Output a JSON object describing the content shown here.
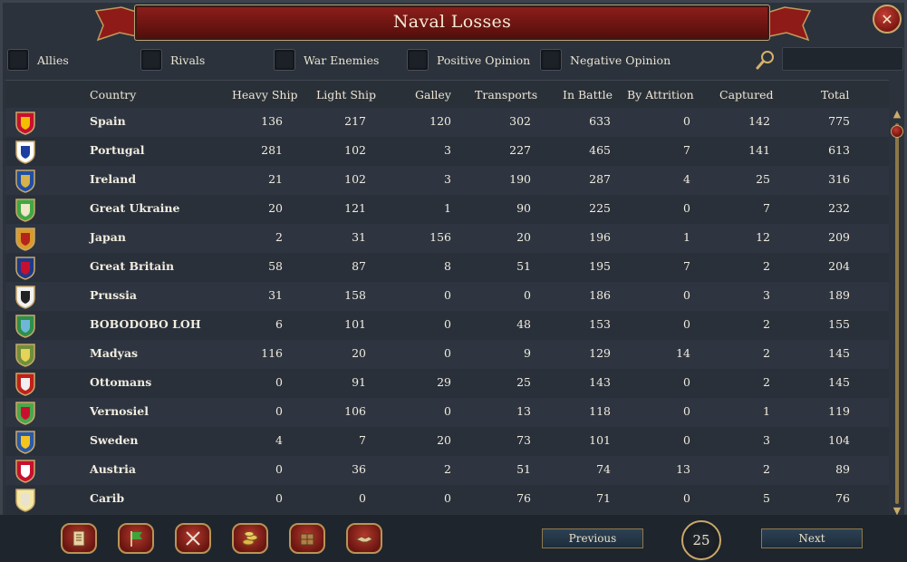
{
  "window": {
    "title": "Naval Losses"
  },
  "filters": [
    {
      "label": "Allies"
    },
    {
      "label": "Rivals"
    },
    {
      "label": "War Enemies"
    },
    {
      "label": "Positive Opinion"
    },
    {
      "label": "Negative Opinion"
    }
  ],
  "search": {
    "value": "",
    "placeholder": ""
  },
  "table": {
    "columns": [
      "Country",
      "Heavy Ship",
      "Light Ship",
      "Galley",
      "Transports",
      "In Battle",
      "By Attrition",
      "Captured",
      "Total"
    ],
    "rows": [
      {
        "flag": "spain-flag",
        "colors": [
          "#c8102e",
          "#f1bf00"
        ],
        "name": "Spain",
        "heavy": "136",
        "light": "217",
        "galley": "120",
        "transports": "302",
        "battle": "633",
        "attrition": "0",
        "captured": "142",
        "total": "775"
      },
      {
        "flag": "portugal-flag",
        "colors": [
          "#ffffff",
          "#1d3f9e"
        ],
        "name": "Portugal",
        "heavy": "281",
        "light": "102",
        "galley": "3",
        "transports": "227",
        "battle": "465",
        "attrition": "7",
        "captured": "141",
        "total": "613"
      },
      {
        "flag": "ireland-flag",
        "colors": [
          "#1f4fa3",
          "#d6b24a"
        ],
        "name": "Ireland",
        "heavy": "21",
        "light": "102",
        "galley": "3",
        "transports": "190",
        "battle": "287",
        "attrition": "4",
        "captured": "25",
        "total": "316"
      },
      {
        "flag": "great-ukraine-flag",
        "colors": [
          "#3fa844",
          "#f0e6c8"
        ],
        "name": "Great Ukraine",
        "heavy": "20",
        "light": "121",
        "galley": "1",
        "transports": "90",
        "battle": "225",
        "attrition": "0",
        "captured": "7",
        "total": "232"
      },
      {
        "flag": "japan-flag",
        "colors": [
          "#d89a2a",
          "#b4231c"
        ],
        "name": "Japan",
        "heavy": "2",
        "light": "31",
        "galley": "156",
        "transports": "20",
        "battle": "196",
        "attrition": "1",
        "captured": "12",
        "total": "209"
      },
      {
        "flag": "great-britain-flag",
        "colors": [
          "#1d3a8a",
          "#c8102e"
        ],
        "name": "Great Britain",
        "heavy": "58",
        "light": "87",
        "galley": "8",
        "transports": "51",
        "battle": "195",
        "attrition": "7",
        "captured": "2",
        "total": "204"
      },
      {
        "flag": "prussia-flag",
        "colors": [
          "#f2f2f2",
          "#222222"
        ],
        "name": "Prussia",
        "heavy": "31",
        "light": "158",
        "galley": "0",
        "transports": "0",
        "battle": "186",
        "attrition": "0",
        "captured": "3",
        "total": "189"
      },
      {
        "flag": "bobodobo-loh-flag",
        "colors": [
          "#2e8f4a",
          "#6fb7d8"
        ],
        "name": "BOBODOBO LOH",
        "heavy": "6",
        "light": "101",
        "galley": "0",
        "transports": "48",
        "battle": "153",
        "attrition": "0",
        "captured": "2",
        "total": "155"
      },
      {
        "flag": "madyas-flag",
        "colors": [
          "#6f8f3a",
          "#e7d25a"
        ],
        "name": "Madyas",
        "heavy": "116",
        "light": "20",
        "galley": "0",
        "transports": "9",
        "battle": "129",
        "attrition": "14",
        "captured": "2",
        "total": "145"
      },
      {
        "flag": "ottomans-flag",
        "colors": [
          "#c0201a",
          "#f0f0f0"
        ],
        "name": "Ottomans",
        "heavy": "0",
        "light": "91",
        "galley": "29",
        "transports": "25",
        "battle": "143",
        "attrition": "0",
        "captured": "2",
        "total": "145"
      },
      {
        "flag": "vernosiel-flag",
        "colors": [
          "#4aa84c",
          "#c8102e"
        ],
        "name": "Vernosiel",
        "heavy": "0",
        "light": "106",
        "galley": "0",
        "transports": "13",
        "battle": "118",
        "attrition": "0",
        "captured": "1",
        "total": "119"
      },
      {
        "flag": "sweden-flag",
        "colors": [
          "#2a5aa8",
          "#f3c51c"
        ],
        "name": "Sweden",
        "heavy": "4",
        "light": "7",
        "galley": "20",
        "transports": "73",
        "battle": "101",
        "attrition": "0",
        "captured": "3",
        "total": "104"
      },
      {
        "flag": "austria-flag",
        "colors": [
          "#c8102e",
          "#ffffff"
        ],
        "name": "Austria",
        "heavy": "0",
        "light": "36",
        "galley": "2",
        "transports": "51",
        "battle": "74",
        "attrition": "13",
        "captured": "2",
        "total": "89"
      },
      {
        "flag": "carib-flag",
        "colors": [
          "#f3e9a6",
          "#e9e2d0"
        ],
        "name": "Carib",
        "heavy": "0",
        "light": "0",
        "galley": "0",
        "transports": "76",
        "battle": "71",
        "attrition": "0",
        "captured": "5",
        "total": "76"
      }
    ]
  },
  "footer": {
    "tabs": [
      {
        "icon": "ledger-icon"
      },
      {
        "icon": "flag-icon"
      },
      {
        "icon": "crossed-swords-icon"
      },
      {
        "icon": "coins-icon"
      },
      {
        "icon": "crate-icon"
      },
      {
        "icon": "handshake-icon"
      }
    ],
    "previous_label": "Previous",
    "next_label": "Next",
    "page": "25"
  },
  "colors": {
    "accent_red": "#7d1712",
    "gold": "#c9a86a",
    "panel": "#2b323b"
  }
}
